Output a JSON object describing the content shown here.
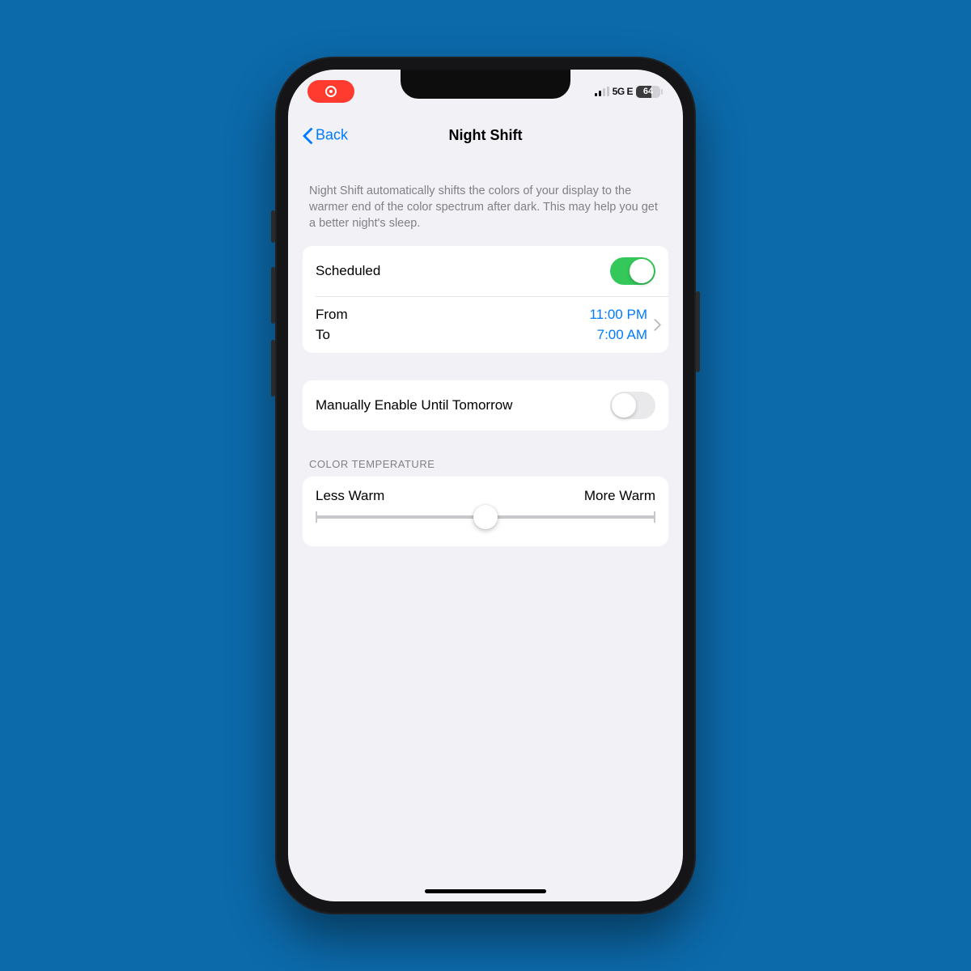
{
  "status": {
    "network": "5G E",
    "battery_pct": "64"
  },
  "nav": {
    "back": "Back",
    "title": "Night Shift"
  },
  "description": "Night Shift automatically shifts the colors of your display to the warmer end of the color spectrum after dark. This may help you get a better night's sleep.",
  "scheduled": {
    "label": "Scheduled",
    "on": true,
    "from_label": "From",
    "to_label": "To",
    "from_time": "11:00 PM",
    "to_time": "7:00 AM"
  },
  "manual": {
    "label": "Manually Enable Until Tomorrow",
    "on": false
  },
  "temperature": {
    "header": "COLOR TEMPERATURE",
    "less": "Less Warm",
    "more": "More Warm",
    "value_pct": 50
  }
}
